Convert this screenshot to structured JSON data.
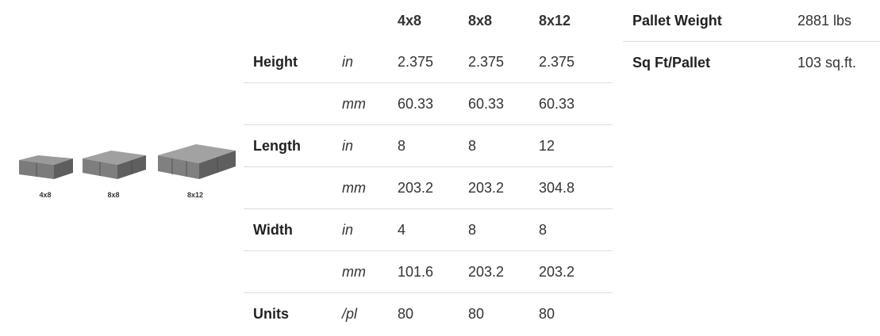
{
  "pavers": [
    {
      "caption": "4x8"
    },
    {
      "caption": "8x8"
    },
    {
      "caption": "8x12"
    }
  ],
  "spec_table": {
    "columns": [
      "4x8",
      "8x8",
      "8x12"
    ],
    "rows": [
      {
        "label": "Height",
        "unit": "in",
        "values": [
          "2.375",
          "2.375",
          "2.375"
        ]
      },
      {
        "label": "",
        "unit": "mm",
        "values": [
          "60.33",
          "60.33",
          "60.33"
        ]
      },
      {
        "label": "Length",
        "unit": "in",
        "values": [
          "8",
          "8",
          "12"
        ]
      },
      {
        "label": "",
        "unit": "mm",
        "values": [
          "203.2",
          "203.2",
          "304.8"
        ]
      },
      {
        "label": "Width",
        "unit": "in",
        "values": [
          "4",
          "8",
          "8"
        ]
      },
      {
        "label": "",
        "unit": "mm",
        "values": [
          "101.6",
          "203.2",
          "203.2"
        ]
      },
      {
        "label": "Units",
        "unit": "/pl",
        "values": [
          "80",
          "80",
          "80"
        ]
      }
    ]
  },
  "pallet_table": [
    {
      "label": "Pallet Weight",
      "value": "2881 lbs"
    },
    {
      "label": "Sq Ft/Pallet",
      "value": "103 sq.ft."
    }
  ]
}
